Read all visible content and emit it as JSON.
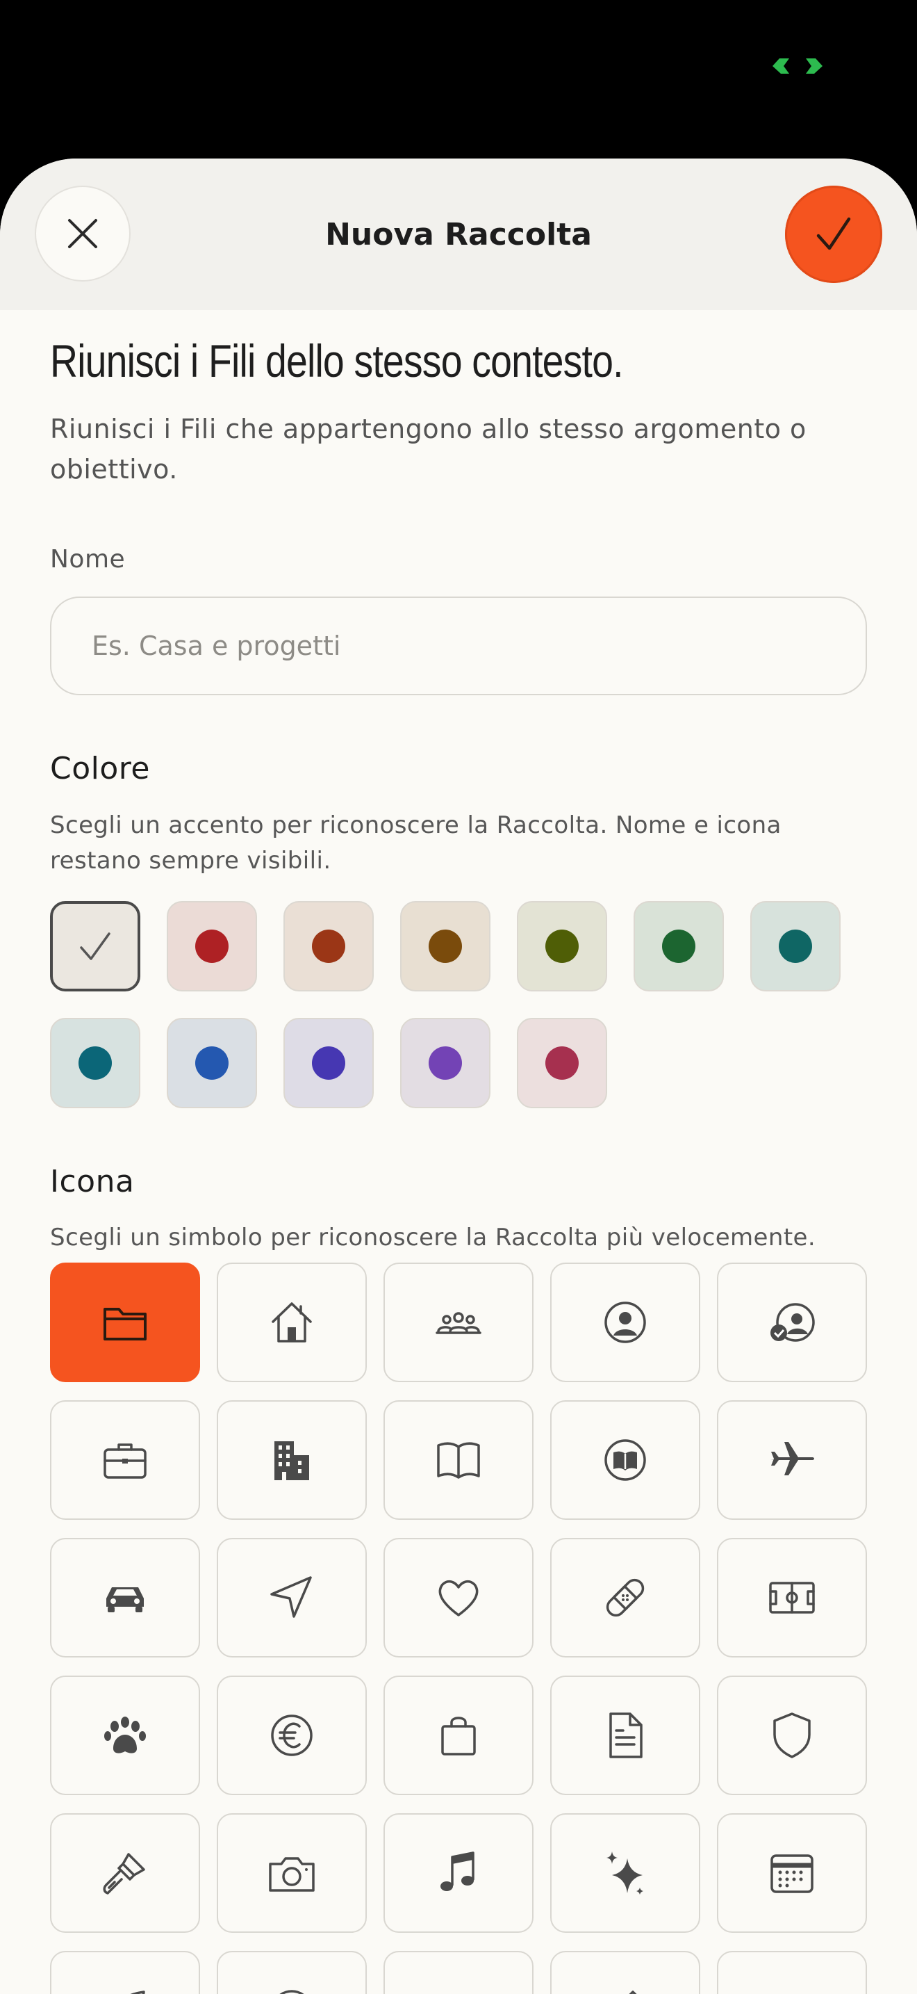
{
  "header": {
    "title": "Nuova Raccolta",
    "close_icon": "close-icon",
    "confirm_icon": "checkmark-icon",
    "accent_color": "#f5541f"
  },
  "intro": {
    "heading": "Riunisci i Fili dello stesso contesto.",
    "description": "Riunisci i Fili che appartengono allo stesso argomento o obiettivo."
  },
  "name_field": {
    "label": "Nome",
    "value": "",
    "placeholder": "Es. Casa e progetti"
  },
  "color_section": {
    "title": "Colore",
    "description": "Scegli un accento per riconoscere la Raccolta. Nome e icona restano sempre visibili.",
    "selected_index": 0,
    "swatches": [
      {
        "name": "neutral",
        "bg": "#ebe7e0",
        "dot": null
      },
      {
        "name": "red",
        "bg": "#ebdbd6",
        "dot": "#ae2124"
      },
      {
        "name": "rust",
        "bg": "#eadfd5",
        "dot": "#9b3616"
      },
      {
        "name": "amber",
        "bg": "#e8dfd2",
        "dot": "#7a4b0c"
      },
      {
        "name": "olive",
        "bg": "#e3e3d4",
        "dot": "#4f5e06"
      },
      {
        "name": "green",
        "bg": "#d9e2d7",
        "dot": "#1c6530"
      },
      {
        "name": "teal",
        "bg": "#d7e2dc",
        "dot": "#0f6664"
      },
      {
        "name": "cyan",
        "bg": "#d7e2e0",
        "dot": "#0b6678"
      },
      {
        "name": "blue",
        "bg": "#dadfe4",
        "dot": "#2458b0"
      },
      {
        "name": "indigo",
        "bg": "#dedce6",
        "dot": "#4637b2"
      },
      {
        "name": "violet",
        "bg": "#e3dde3",
        "dot": "#7343b5"
      },
      {
        "name": "raspberry",
        "bg": "#ecdfde",
        "dot": "#a6304f"
      }
    ]
  },
  "icon_section": {
    "title": "Icona",
    "description": "Scegli un simbolo per riconoscere la Raccolta più velocemente.",
    "selected_index": 0,
    "icons": [
      "folder-icon",
      "house-icon",
      "group-icon",
      "person-circle-icon",
      "person-check-icon",
      "briefcase-icon",
      "building-icon",
      "book-icon",
      "book-circle-icon",
      "airplane-icon",
      "car-icon",
      "location-arrow-icon",
      "heart-icon",
      "bandage-icon",
      "soccer-field-icon",
      "paw-icon",
      "euro-icon",
      "shopping-bag-icon",
      "document-icon",
      "shield-icon",
      "paintbrush-icon",
      "camera-icon",
      "music-note-icon",
      "sparkles-icon",
      "calendar-icon",
      "leaf-icon",
      "clock-icon",
      "arrow-icon",
      "pencil-icon",
      "gift-icon"
    ]
  }
}
